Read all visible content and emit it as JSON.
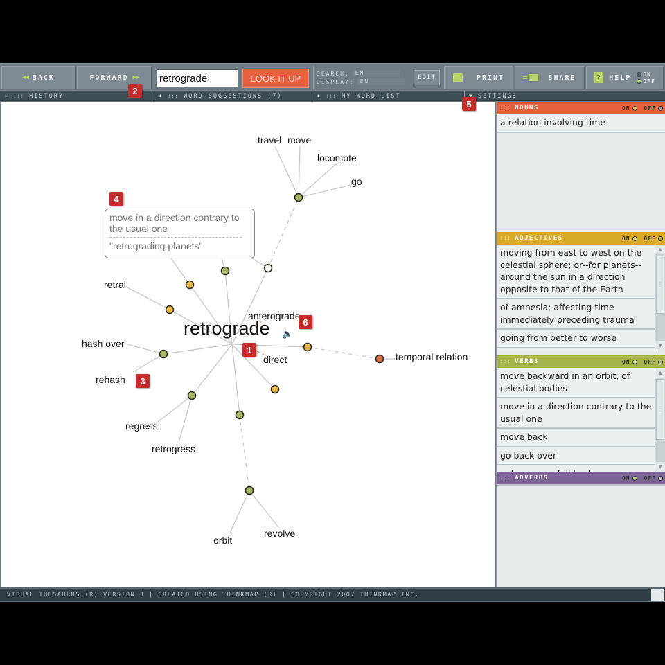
{
  "toolbar": {
    "back_label": "BACK",
    "forward_label": "FORWARD",
    "search_value": "retrograde",
    "lookup_label": "LOOK IT UP",
    "search_lang_label": "SEARCH:",
    "search_lang_value": "EN",
    "display_lang_label": "DISPLAY:",
    "display_lang_value": "EN",
    "edit_label": "EDIT",
    "print_label": "PRINT",
    "share_label": "SHARE",
    "help_label": "HELP",
    "help_on": "ON",
    "help_off": "OFF",
    "help_state": "off"
  },
  "panels": {
    "history": "HISTORY",
    "word_suggestions": "WORD SUGGESTIONS (7)",
    "my_word_list": "MY WORD LIST",
    "settings": "SETTINGS"
  },
  "graph": {
    "center_word": "retrograde",
    "words": [
      {
        "id": "travel",
        "label": "travel"
      },
      {
        "id": "move",
        "label": "move"
      },
      {
        "id": "locomote",
        "label": "locomote"
      },
      {
        "id": "go",
        "label": "go"
      },
      {
        "id": "retral",
        "label": "retral"
      },
      {
        "id": "hash-over",
        "label": "hash over"
      },
      {
        "id": "rehash",
        "label": "rehash"
      },
      {
        "id": "regress",
        "label": "regress"
      },
      {
        "id": "retrogress",
        "label": "retrogress"
      },
      {
        "id": "anterograde",
        "label": "anterograde"
      },
      {
        "id": "direct",
        "label": "direct"
      },
      {
        "id": "temporal-relation",
        "label": "temporal relation"
      },
      {
        "id": "orbit",
        "label": "orbit"
      },
      {
        "id": "revolve",
        "label": "revolve"
      }
    ],
    "tooltip": {
      "definition": "move in a direction contrary to the usual one",
      "example": "\"retrograding planets\""
    },
    "markers": [
      "1",
      "2",
      "3",
      "4",
      "5",
      "6"
    ],
    "node_colors": {
      "verb": "#a8b86a",
      "adjective": "#e8b84a",
      "noun": "#d86a4a",
      "selected": "#ffffff"
    }
  },
  "sidebar": {
    "toggle_on": "ON",
    "toggle_off": "OFF",
    "categories": [
      {
        "name": "NOUNS",
        "color": "#e8613f",
        "definitions": [
          "a relation involving time"
        ]
      },
      {
        "name": "ADJECTIVES",
        "color": "#d9a928",
        "definitions": [
          "moving from east to west on the celestial sphere; or--for planets--around the sun in a direction opposite to that of the Earth",
          "of amnesia; affecting time immediately preceding trauma",
          "going from better to worse"
        ]
      },
      {
        "name": "VERBS",
        "color": "#a6b34c",
        "definitions": [
          "move backward in an orbit, of celestial bodies",
          "move in a direction contrary to the usual one",
          "move back",
          "go back over",
          "get worse or fall back"
        ]
      },
      {
        "name": "ADVERBS",
        "color": "#7b6394",
        "definitions": []
      }
    ]
  },
  "footer": {
    "text": "VISUAL THESAURUS (R) VERSION 3 | CREATED USING THINKMAP (R) | COPYRIGHT 2007 THINKMAP INC."
  }
}
